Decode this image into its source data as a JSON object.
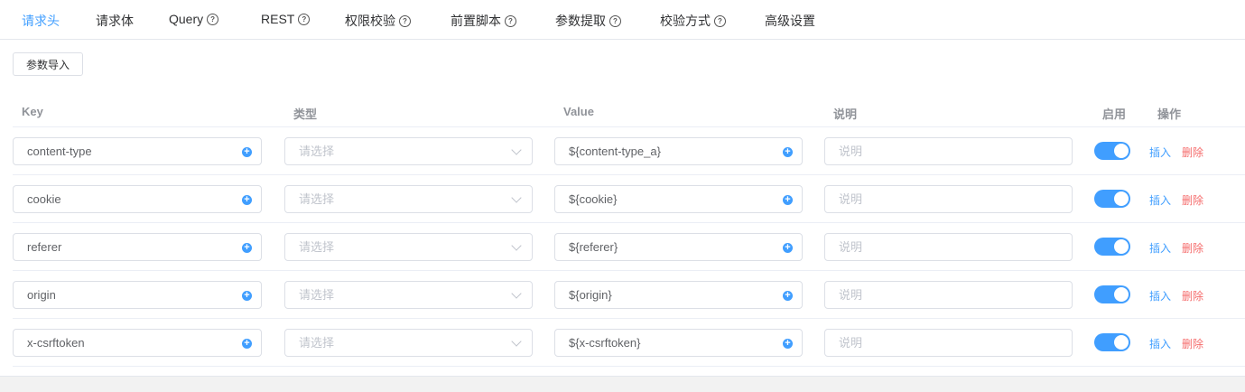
{
  "tabs": [
    {
      "label": "请求头",
      "active": true,
      "help": false
    },
    {
      "label": "请求体",
      "active": false,
      "help": false
    },
    {
      "label": "Query",
      "active": false,
      "help": true
    },
    {
      "label": "REST",
      "active": false,
      "help": true
    },
    {
      "label": "权限校验",
      "active": false,
      "help": true
    },
    {
      "label": "前置脚本",
      "active": false,
      "help": true
    },
    {
      "label": "参数提取",
      "active": false,
      "help": true
    },
    {
      "label": "校验方式",
      "active": false,
      "help": true
    },
    {
      "label": "高级设置",
      "active": false,
      "help": false
    }
  ],
  "help_glyph": "?",
  "import_button": "参数导入",
  "columns": {
    "key": "Key",
    "type": "类型",
    "value": "Value",
    "desc": "说明",
    "enabled": "启用",
    "ops": "操作"
  },
  "type_placeholder": "请选择",
  "desc_placeholder": "说明",
  "insert_label": "插入",
  "delete_label": "删除",
  "plus_glyph": "+",
  "accent_color": "#409eff",
  "danger_color": "#f56c6c",
  "rows": [
    {
      "key": "content-type",
      "type": "",
      "value": "${content-type_a}",
      "desc": "",
      "enabled": true
    },
    {
      "key": "cookie",
      "type": "",
      "value": "${cookie}",
      "desc": "",
      "enabled": true
    },
    {
      "key": "referer",
      "type": "",
      "value": "${referer}",
      "desc": "",
      "enabled": true
    },
    {
      "key": "origin",
      "type": "",
      "value": "${origin}",
      "desc": "",
      "enabled": true
    },
    {
      "key": "x-csrftoken",
      "type": "",
      "value": "${x-csrftoken}",
      "desc": "",
      "enabled": true
    }
  ]
}
